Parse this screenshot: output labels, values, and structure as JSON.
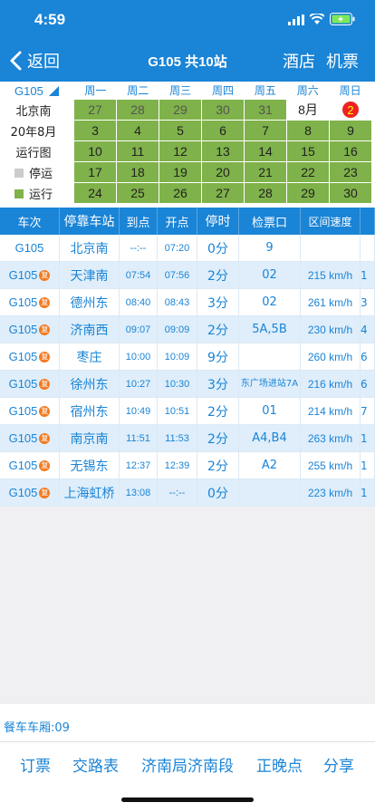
{
  "status": {
    "time": "4:59"
  },
  "nav": {
    "back": "返回",
    "title": "G105 共10站",
    "hotel": "酒店",
    "flight": "机票"
  },
  "calendar": {
    "train": "G105",
    "left_labels": [
      "北京南",
      "20年8月",
      "运行图"
    ],
    "legend_stop": "停运",
    "legend_run": "运行",
    "weekdays": [
      "周一",
      "周二",
      "周三",
      "周四",
      "周五",
      "周六",
      "周日"
    ],
    "rows": [
      [
        "27",
        "28",
        "29",
        "30",
        "31",
        "8月",
        "2"
      ],
      [
        "3",
        "4",
        "5",
        "6",
        "7",
        "8",
        "9"
      ],
      [
        "10",
        "11",
        "12",
        "13",
        "14",
        "15",
        "16"
      ],
      [
        "17",
        "18",
        "19",
        "20",
        "21",
        "22",
        "23"
      ],
      [
        "24",
        "25",
        "26",
        "27",
        "28",
        "29",
        "30"
      ]
    ],
    "colors": {
      "run": "#7fb24a",
      "stop": "#cccccc",
      "today": "#e22222"
    }
  },
  "table": {
    "headers": [
      "车次",
      "停靠车站",
      "到点",
      "开点",
      "停时",
      "检票口",
      "区间速度"
    ],
    "rows": [
      {
        "train": "G105",
        "badge": "",
        "station": "北京南",
        "arr": "--:--",
        "dep": "07:20",
        "stay": "0分",
        "gate": "9",
        "speed": "",
        "extra": ""
      },
      {
        "train": "G105",
        "badge": "复",
        "station": "天津南",
        "arr": "07:54",
        "dep": "07:56",
        "stay": "2分",
        "gate": "02",
        "speed": "215 km/h",
        "extra": "1"
      },
      {
        "train": "G105",
        "badge": "复",
        "station": "德州东",
        "arr": "08:40",
        "dep": "08:43",
        "stay": "3分",
        "gate": "02",
        "speed": "261 km/h",
        "extra": "3"
      },
      {
        "train": "G105",
        "badge": "复",
        "station": "济南西",
        "arr": "09:07",
        "dep": "09:09",
        "stay": "2分",
        "gate": "5A,5B",
        "speed": "230 km/h",
        "extra": "4"
      },
      {
        "train": "G105",
        "badge": "复",
        "station": "枣庄",
        "arr": "10:00",
        "dep": "10:09",
        "stay": "9分",
        "gate": "",
        "speed": "260 km/h",
        "extra": "6"
      },
      {
        "train": "G105",
        "badge": "复",
        "station": "徐州东",
        "arr": "10:27",
        "dep": "10:30",
        "stay": "3分",
        "gate": "东广场进站7A",
        "speed": "216 km/h",
        "extra": "6"
      },
      {
        "train": "G105",
        "badge": "复",
        "station": "宿州东",
        "arr": "10:49",
        "dep": "10:51",
        "stay": "2分",
        "gate": "01",
        "speed": "214 km/h",
        "extra": "7"
      },
      {
        "train": "G105",
        "badge": "复",
        "station": "南京南",
        "arr": "11:51",
        "dep": "11:53",
        "stay": "2分",
        "gate": "A4,B4",
        "speed": "263 km/h",
        "extra": "1"
      },
      {
        "train": "G105",
        "badge": "复",
        "station": "无锡东",
        "arr": "12:37",
        "dep": "12:39",
        "stay": "2分",
        "gate": "A2",
        "speed": "255 km/h",
        "extra": "1"
      },
      {
        "train": "G105",
        "badge": "复",
        "station": "上海虹桥",
        "arr": "13:08",
        "dep": "--:--",
        "stay": "0分",
        "gate": "",
        "speed": "223 km/h",
        "extra": "1"
      }
    ]
  },
  "footer": {
    "dining": "餐车车厢:09"
  },
  "bottom": {
    "order": "订票",
    "routing": "交路表",
    "bureau": "济南局济南段",
    "punctual": "正晚点",
    "share": "分享"
  }
}
